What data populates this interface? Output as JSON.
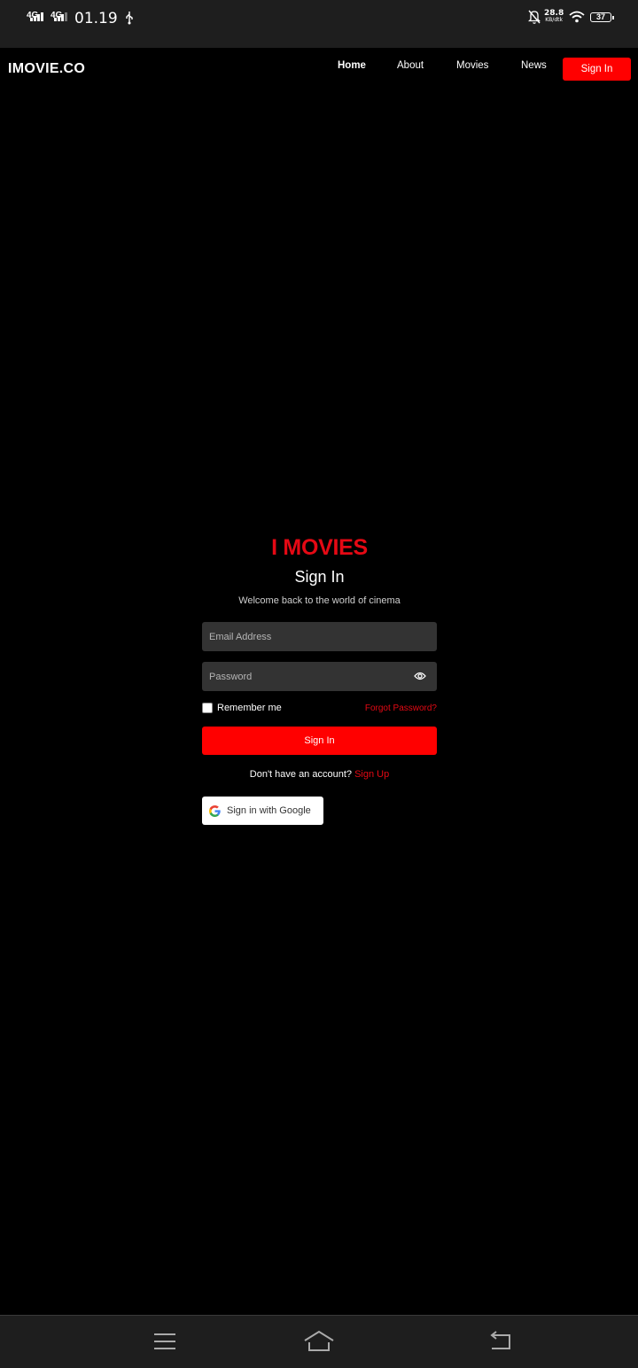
{
  "status_bar": {
    "network_1": "4G",
    "network_2": "4G",
    "time": "01.19",
    "speed_value": "28.8",
    "speed_unit": "KB/dtk",
    "battery": "37",
    "icons": [
      "usb-icon",
      "mute-icon",
      "wifi-icon",
      "battery-icon"
    ]
  },
  "header": {
    "brand": "IMOVIE.CO",
    "nav": [
      "Home",
      "About",
      "Movies",
      "News"
    ],
    "active_nav": "Home",
    "sign_in": "Sign In"
  },
  "form": {
    "logo": "I MOVIES",
    "heading": "Sign In",
    "subheading": "Welcome back to the world of cinema",
    "email_placeholder": "Email Address",
    "password_placeholder": "Password",
    "remember": "Remember me",
    "forgot": "Forgot Password?",
    "submit": "Sign In",
    "no_account": "Don't have an account?",
    "signup": "Sign Up",
    "google": "Sign in with Google"
  },
  "colors": {
    "accent": "#ff0000",
    "logo_red": "#e50914",
    "field_bg": "#333333",
    "background": "#000000"
  },
  "bottom_bar": {
    "icons": [
      "menu-icon",
      "home-icon",
      "back-icon"
    ]
  }
}
